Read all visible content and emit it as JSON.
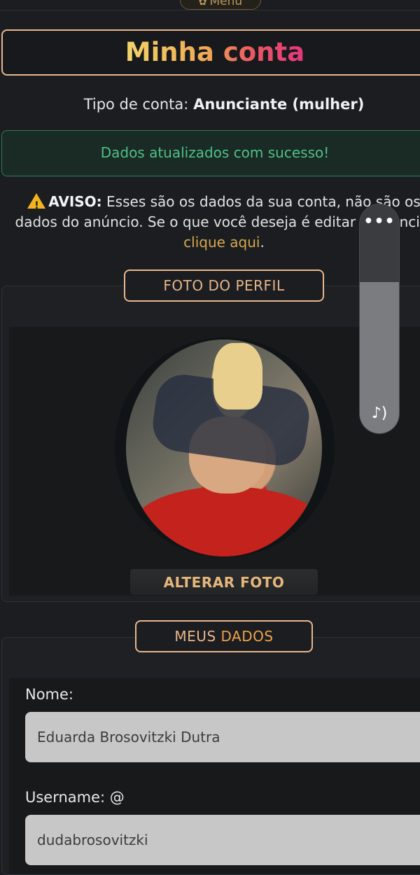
{
  "menu": {
    "label": "Menu",
    "icon": "gear-icon"
  },
  "title": {
    "text": "Minha conta"
  },
  "account_type": {
    "label": "Tipo de conta:",
    "value": "Anunciante (mulher)"
  },
  "success": {
    "message": "Dados atualizados com sucesso!"
  },
  "warning": {
    "icon": "warning-icon",
    "bold": "AVISO:",
    "line1": " Esses são os dados da sua conta, não são os",
    "line2": "dados do anúncio. Se o que você deseja é editar o anúncio,",
    "link": "clique aqui",
    "after_link": "."
  },
  "profile_photo": {
    "label": "FOTO DO PERFIL",
    "change_button": "ALTERAR FOTO"
  },
  "my_data": {
    "label_part1": "MEUS ",
    "label_part2": "DADOS",
    "name_label": "Nome:",
    "name_value": "Eduarda Brosovitzki Dutra",
    "username_label": "Username: @",
    "username_value": "dudabrosovitzki"
  },
  "overlay": {
    "menu_icon": "more-dots-icon",
    "dots": "•••",
    "sound_icon": "music-note-icon",
    "sound_glyph": "♪)",
    "volume_level": 0.66
  }
}
